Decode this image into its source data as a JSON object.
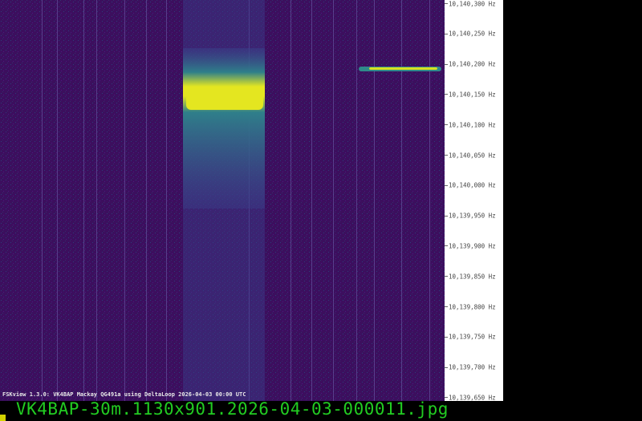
{
  "chart_data": {
    "type": "heatmap",
    "title": "FSKview 1.3.0: VK4BAP Mackay QG491a using DeltaLoop 2026-04-03 00:00 UTC",
    "ylabel": "Hz",
    "ylim": [
      10139650,
      10140300
    ],
    "y_ticks": [
      "10,140,300 Hz",
      "10,140,250 Hz",
      "10,140,200 Hz",
      "10,140,150 Hz",
      "10,140,100 Hz",
      "10,140,050 Hz",
      "10,140,000 Hz",
      "10,139,950 Hz",
      "10,139,900 Hz",
      "10,139,850 Hz",
      "10,139,800 Hz",
      "10,139,750 Hz",
      "10,139,700 Hz",
      "10,139,650 Hz"
    ],
    "signals": [
      {
        "freq_hz": 10140140,
        "time_fraction": [
          0.41,
          0.6
        ],
        "intensity": "high"
      },
      {
        "freq_hz": 10140190,
        "time_fraction": [
          0.81,
          0.99
        ],
        "intensity": "medium"
      }
    ],
    "colors": {
      "background": "#3c0f5e",
      "signal": "#e8e81e",
      "mid": "#2a8a8a"
    }
  },
  "footer": {
    "filename": "VK4BAP-30m.1130x901.2026-04-03-000011.jpg"
  }
}
